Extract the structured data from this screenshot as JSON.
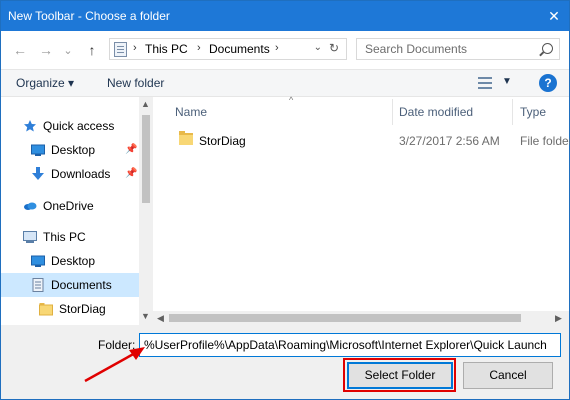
{
  "window": {
    "title": "New Toolbar - Choose a folder",
    "close_glyph": "✕"
  },
  "nav": {
    "back_glyph": "←",
    "forward_glyph": "→",
    "recent_glyph": "⌄",
    "up_glyph": "↑",
    "breadcrumb": [
      "This PC",
      "Documents"
    ],
    "breadcrumb_sep": "›",
    "dropdown_glyph": "⌄",
    "refresh_glyph": "↻",
    "search_placeholder": "Search Documents"
  },
  "toolbar": {
    "organize_label": "Organize ▾",
    "new_folder_label": "New folder",
    "view_dropdown_glyph": "▼",
    "help_glyph": "?"
  },
  "sidebar": {
    "items": [
      {
        "label": "Quick access",
        "icon": "star-icon",
        "pinned": false,
        "selected": false
      },
      {
        "label": "Desktop",
        "icon": "desktop-icon",
        "pinned": true,
        "selected": false
      },
      {
        "label": "Downloads",
        "icon": "download-icon",
        "pinned": true,
        "selected": false
      },
      {
        "label": "OneDrive",
        "icon": "cloud-icon",
        "pinned": false,
        "selected": false
      },
      {
        "label": "This PC",
        "icon": "computer-icon",
        "pinned": false,
        "selected": false
      },
      {
        "label": "Desktop",
        "icon": "desktop-icon",
        "pinned": false,
        "selected": false
      },
      {
        "label": "Documents",
        "icon": "document-icon",
        "pinned": false,
        "selected": true
      },
      {
        "label": "StorDiag",
        "icon": "folder-icon",
        "pinned": false,
        "selected": false
      }
    ],
    "pin_glyph": "📌"
  },
  "file_list": {
    "columns": [
      "Name",
      "Date modified",
      "Type"
    ],
    "sort_glyph": "^",
    "rows": [
      {
        "name": "StorDiag",
        "date": "3/27/2017 2:56 AM",
        "type": "File folder"
      }
    ]
  },
  "footer": {
    "folder_label": "Folder:",
    "folder_value": "%UserProfile%\\AppData\\Roaming\\Microsoft\\Internet Explorer\\Quick Launch",
    "select_label": "Select Folder",
    "cancel_label": "Cancel"
  },
  "colors": {
    "title_bar": "#1e78d7",
    "accent": "#0078d7",
    "annotation": "#e00000",
    "selection": "#cce8ff"
  }
}
